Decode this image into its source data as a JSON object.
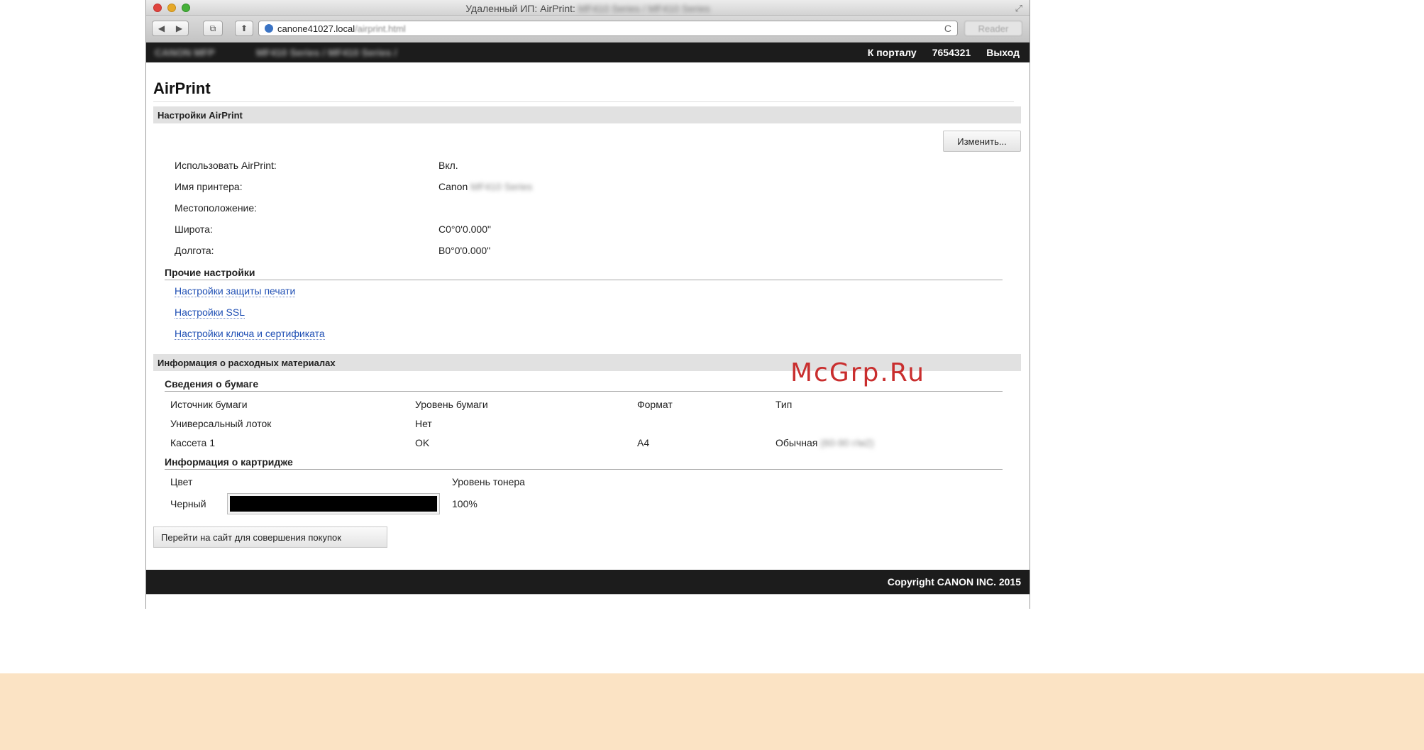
{
  "window": {
    "title": "Удаленный ИП: AirPrint:",
    "title_blurred": "MF410 Series / MF410 Series"
  },
  "toolbar": {
    "back_icon": "◀",
    "forward_icon": "▶",
    "share_icon": "⧉",
    "home_icon": "⬆",
    "address_host": "canone41027.local",
    "address_path": "/airprint.html",
    "reload_icon": "C",
    "reader_label": "Reader"
  },
  "topnav": {
    "left_blurred_1": "CANON MFP",
    "left_blurred_2": "MF410 Series / MF410 Series /",
    "portal_link": "К порталу",
    "user_id": "7654321",
    "logout": "Выход"
  },
  "page": {
    "title": "AirPrint"
  },
  "airprint_settings": {
    "section_title": "Настройки AirPrint",
    "edit_button": "Изменить...",
    "rows": [
      {
        "label": "Использовать AirPrint:",
        "value": "Вкл."
      },
      {
        "label": "Имя принтера:",
        "value": "Canon",
        "value_blurred": "MF410 Series"
      },
      {
        "label": "Местоположение:",
        "value": ""
      },
      {
        "label": "Широта:",
        "value": "С0°0'0.000\""
      },
      {
        "label": "Долгота:",
        "value": "В0°0'0.000\""
      }
    ]
  },
  "other_settings": {
    "heading": "Прочие настройки",
    "links": [
      "Настройки защиты печати",
      "Настройки SSL",
      "Настройки ключа и сертификата"
    ]
  },
  "consumables": {
    "section_title": "Информация о расходных материалах",
    "paper": {
      "heading": "Сведения о бумаге",
      "columns": [
        "Источник бумаги",
        "Уровень бумаги",
        "Формат",
        "Тип"
      ],
      "rows": [
        {
          "source": "Универсальный лоток",
          "level": "Нет",
          "format": "",
          "type": "",
          "type_blurred": ""
        },
        {
          "source": "Кассета 1",
          "level": "OK",
          "format": "A4",
          "type": "Обычная",
          "type_blurred": "(60-90 г/м2)"
        }
      ]
    },
    "cartridge": {
      "heading": "Информация о картридже",
      "columns": [
        "Цвет",
        "Уровень тонера"
      ],
      "rows": [
        {
          "color": "Черный",
          "level_text": "100%",
          "level_fraction": 1.0
        }
      ]
    },
    "shop_button": "Перейти на сайт для совершения покупок"
  },
  "footer": {
    "copyright": "Copyright CANON INC. 2015"
  },
  "watermark": "McGrp.Ru"
}
